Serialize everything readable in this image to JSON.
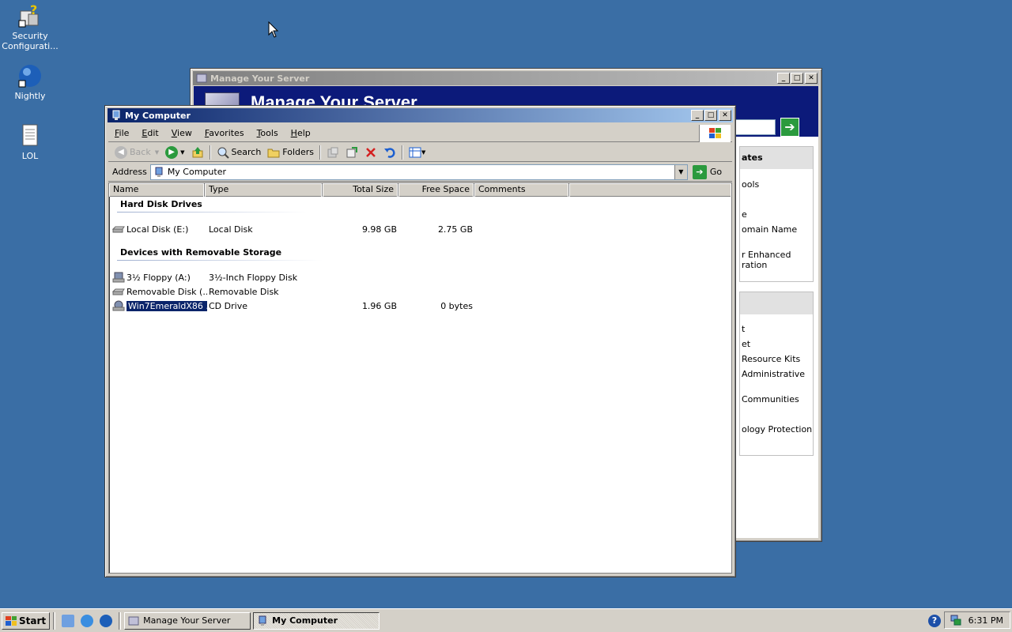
{
  "desktop": {
    "icons": [
      {
        "label": "Security Configurati..."
      },
      {
        "label": "Nightly"
      },
      {
        "label": "LOL"
      }
    ]
  },
  "manage_server": {
    "title": "Manage Your Server",
    "banner_title": "Manage Your Server",
    "section1": {
      "header": "ates",
      "items": [
        "ools",
        "e",
        "omain Name",
        "r Enhanced",
        "ration"
      ]
    },
    "section2": {
      "items": [
        "t",
        "et",
        "Resource Kits",
        "Administrative",
        "Communities",
        "ology Protection"
      ]
    }
  },
  "my_computer": {
    "title": "My Computer",
    "menu": [
      "File",
      "Edit",
      "View",
      "Favorites",
      "Tools",
      "Help"
    ],
    "toolbar": {
      "back": "Back",
      "search": "Search",
      "folders": "Folders"
    },
    "address": {
      "label": "Address",
      "value": "My Computer",
      "go": "Go"
    },
    "columns": [
      "Name",
      "Type",
      "Total Size",
      "Free Space",
      "Comments"
    ],
    "groups": [
      {
        "header": "Hard Disk Drives",
        "rows": [
          {
            "name": "Local Disk (E:)",
            "type": "Local Disk",
            "total": "9.98 GB",
            "free": "2.75 GB"
          }
        ]
      },
      {
        "header": "Devices with Removable Storage",
        "rows": [
          {
            "name": "3½ Floppy (A:)",
            "type": "3½-Inch Floppy Disk",
            "total": "",
            "free": ""
          },
          {
            "name": "Removable Disk (...",
            "type": "Removable Disk",
            "total": "",
            "free": ""
          },
          {
            "name": "Win7EmeraldX86 ...",
            "type": "CD Drive",
            "total": "1.96 GB",
            "free": "0 bytes",
            "selected": true
          }
        ]
      }
    ]
  },
  "taskbar": {
    "start": "Start",
    "tasks": [
      "Manage Your Server",
      "My Computer"
    ],
    "clock": "6:31 PM"
  },
  "colors": {
    "desktop": "#3a6ea5",
    "title_active": "#0a246a",
    "selection": "#0a246a"
  }
}
